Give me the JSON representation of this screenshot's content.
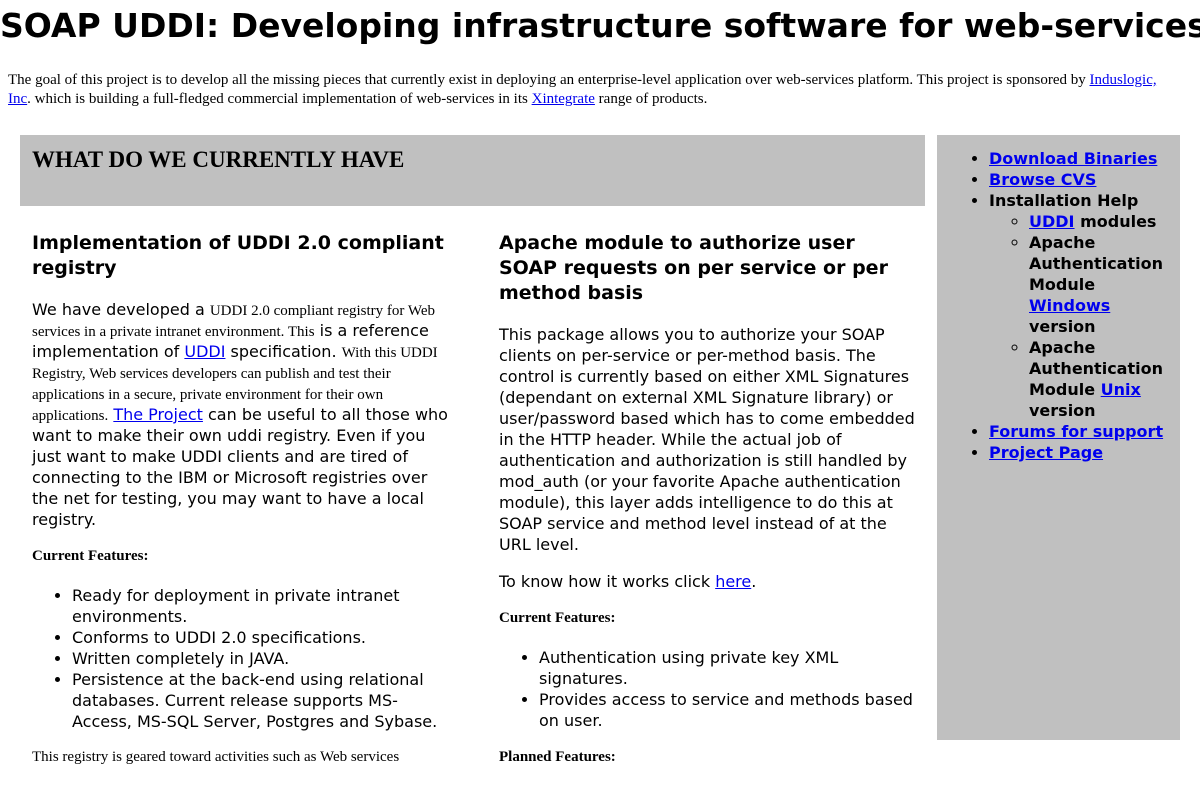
{
  "page": {
    "title": "SOAP UDDI: Developing infrastructure software for web-services",
    "intro": {
      "text1": "The goal of this project is to develop all the missing pieces that currently exist in deploying an enterprise-level application over web-services platform. This project is sponsored by ",
      "link1": "Induslogic, Inc",
      "text2": ". which is building a full-fledged commercial implementation of web-services in its ",
      "link2": "Xintegrate",
      "text3": " range of products."
    }
  },
  "band": {
    "heading": "WHAT DO WE CURRENTLY HAVE"
  },
  "sidebar": {
    "download": "Download Binaries",
    "browse": "Browse CVS",
    "install_help": "Installation Help",
    "uddi_link": "UDDI",
    "uddi_suffix": " modules",
    "apache_win_prefix": "Apache Authentication Module ",
    "windows_link": "Windows",
    "version": " version",
    "apache_unix_prefix": "Apache Authentication Module ",
    "unix_link": "Unix",
    "version2": " version",
    "forums": "Forums for support",
    "project_page": "Project Page"
  },
  "left": {
    "heading": "Implementation of UDDI 2.0 compliant registry",
    "p1_a": "We have developed a ",
    "p1_b": "UDDI 2.0 compliant registry for Web services in a private intranet environment. This",
    "p1_c": " is a reference implementation of ",
    "p1_uddi": "UDDI",
    "p1_d": "  specification. ",
    "p1_e": "With this UDDI Registry, Web services developers can publish and test their applications in a secure, private environment for their own applications.",
    "p1_project": "The Project",
    "p1_f": " can be useful to all those who want to make their own uddi registry. Even if you just want to make UDDI clients and are tired of connecting to the IBM or Microsoft registries over the net for testing, you may want to have a local registry.",
    "features_heading": "Current Features:",
    "features": [
      "Ready for deployment in private intranet environments.",
      "Conforms to UDDI 2.0 specifications.",
      "Written completely in JAVA.",
      "Persistence at the back-end using relational databases. Current release supports MS-Access, MS-SQL Server, Postgres and Sybase."
    ],
    "trailing": "This registry is geared toward activities such as Web services"
  },
  "right": {
    "heading": "Apache module to authorize user SOAP requests on per service or per method basis",
    "p1": "This package allows you to authorize your SOAP clients on per-service or per-method basis. The control is currently based on either XML Signatures (dependant on external XML Signature library) or user/password based which has to come embedded in the HTTP header. While the actual job of authentication and authorization is still handled by mod_auth (or your favorite Apache authentication module), this layer adds intelligence to do this at SOAP service and method level instead of at the URL level.",
    "know_prefix": " To know how it works click ",
    "know_link": "here",
    "know_suffix": ".",
    "features_heading": "Current Features:",
    "features": [
      "Authentication using private key XML signatures.",
      "Provides access to service and methods based on user."
    ],
    "planned_heading": "Planned Features:"
  }
}
